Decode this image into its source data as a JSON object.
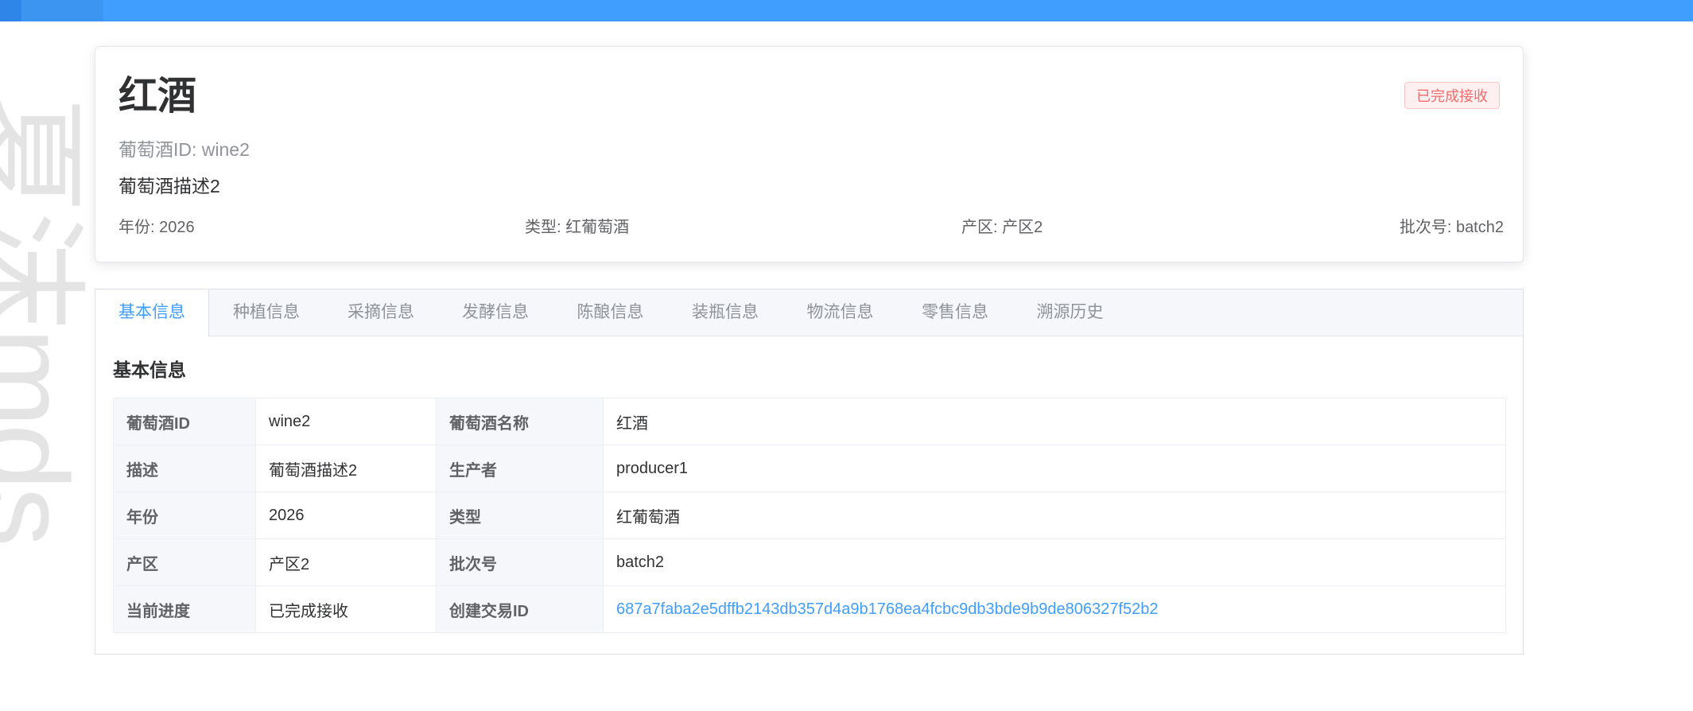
{
  "watermark": "夏沫mds",
  "wine": {
    "name": "红酒",
    "status": "已完成接收",
    "id_line": "葡萄酒ID: wine2",
    "description": "葡萄酒描述2",
    "meta": {
      "year": "年份: 2026",
      "type": "类型: 红葡萄酒",
      "region": "产区: 产区2",
      "batch": "批次号: batch2"
    }
  },
  "tabs": [
    {
      "label": "基本信息",
      "active": true
    },
    {
      "label": "种植信息"
    },
    {
      "label": "采摘信息"
    },
    {
      "label": "发酵信息"
    },
    {
      "label": "陈酿信息"
    },
    {
      "label": "装瓶信息"
    },
    {
      "label": "物流信息"
    },
    {
      "label": "零售信息"
    },
    {
      "label": "溯源历史"
    }
  ],
  "section_title": "基本信息",
  "table": {
    "rows": [
      {
        "k1": "葡萄酒ID",
        "v1": "wine2",
        "k2": "葡萄酒名称",
        "v2": "红酒"
      },
      {
        "k1": "描述",
        "v1": "葡萄酒描述2",
        "k2": "生产者",
        "v2": "producer1"
      },
      {
        "k1": "年份",
        "v1": "2026",
        "k2": "类型",
        "v2": "红葡萄酒"
      },
      {
        "k1": "产区",
        "v1": "产区2",
        "k2": "批次号",
        "v2": "batch2"
      },
      {
        "k1": "当前进度",
        "v1": "已完成接收",
        "k2": "创建交易ID",
        "v2": "687a7faba2e5dffb2143db357d4a9b1768ea4fcbc9db3bde9b9de806327f52b2"
      }
    ]
  },
  "colors": {
    "accent": "#409eff",
    "status_red": "#f56c6c"
  }
}
